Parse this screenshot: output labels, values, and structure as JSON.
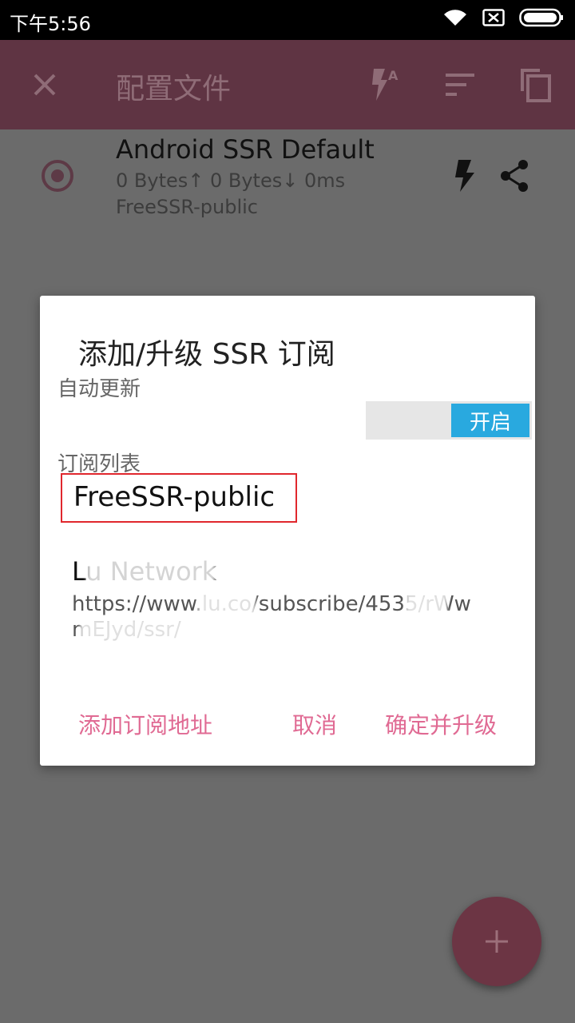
{
  "status_bar": {
    "time": "下午5:56",
    "icons": [
      "wifi-icon",
      "no-sim-icon",
      "battery-icon"
    ]
  },
  "toolbar": {
    "close_icon": "close-icon",
    "title": "配置文件",
    "actions": [
      "flash-auto-icon",
      "sort-icon",
      "copy-icon"
    ]
  },
  "profile": {
    "name": "Android SSR Default",
    "stats": "0 Bytes↑  0 Bytes↓  0ms",
    "group": "FreeSSR-public",
    "actions": [
      "bolt-icon",
      "share-icon"
    ]
  },
  "dialog": {
    "title": "添加/升级 SSR 订阅",
    "auto_update_label": "自动更新",
    "switch_label": "开启",
    "list_label": "订阅列表",
    "subscription_name": "FreeSSR-public",
    "entry": {
      "name": "Lu Network",
      "url": "https://www.lu.co/subscribe/4535/rWwmEJyd/ssr/"
    },
    "buttons": {
      "add": "添加订阅地址",
      "cancel": "取消",
      "confirm": "确定并升级"
    }
  },
  "fab": {
    "icon": "plus-icon"
  },
  "colors": {
    "accent": "#e06a93",
    "switch_on": "#29a9df",
    "highlight_border": "#e0272d",
    "toolbar_dimmed": "#5f3443",
    "scrim": "#6b6b6b"
  }
}
